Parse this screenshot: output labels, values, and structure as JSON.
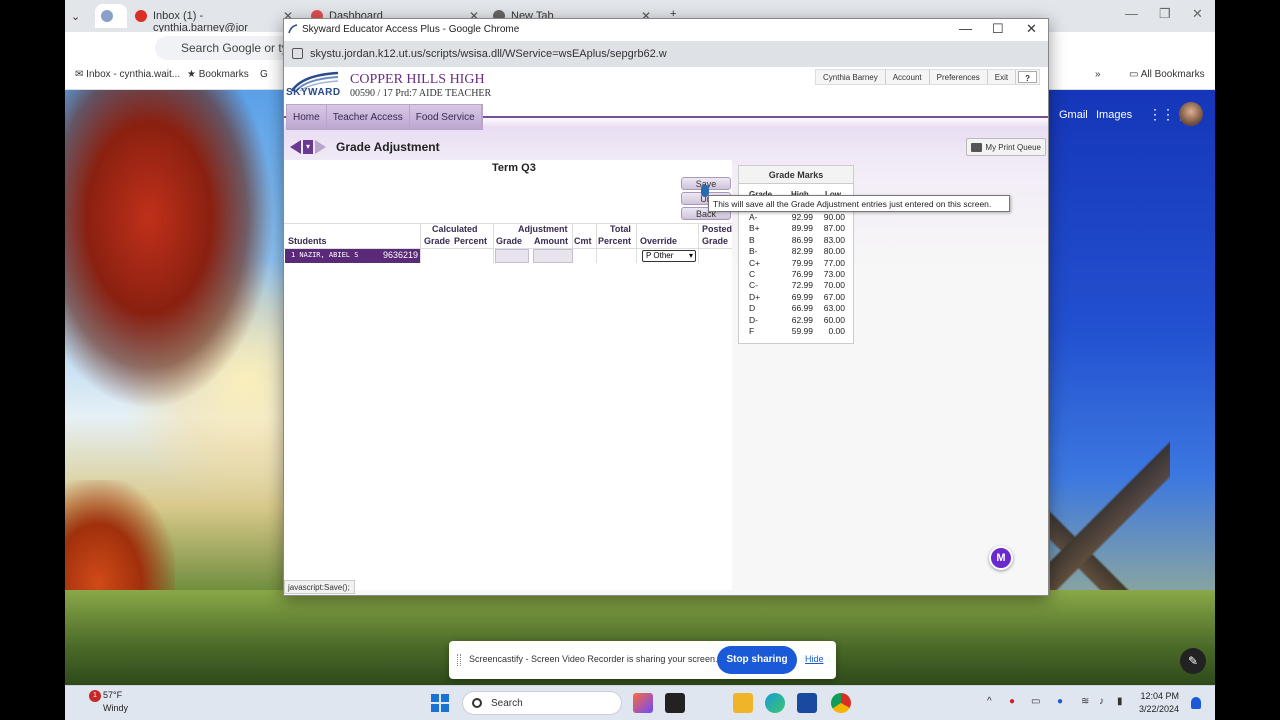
{
  "background_browser": {
    "tabs": [
      {
        "label": ""
      },
      {
        "label": "Inbox (1) - cynthia.barney@jor"
      },
      {
        "label": "Dashboard"
      },
      {
        "label": "New Tab"
      }
    ],
    "omnibox_placeholder": "Search Google or type",
    "bookmarks": [
      "Inbox - cynthia.wait...",
      "Bookmarks",
      "G"
    ],
    "all_bookmarks": "All Bookmarks",
    "google_links": [
      "Gmail",
      "Images"
    ]
  },
  "popup": {
    "title": "Skyward Educator Access Plus - Google Chrome",
    "url": "skystu.jordan.k12.ut.us/scripts/wsisa.dll/WService=wsEAplus/sepgrb62.w",
    "logo_text": "SKYWARD",
    "school_name": "COPPER HILLS HIGH",
    "school_sub": "00590 / 17 Prd:7 AIDE TEACHER",
    "top_links": [
      "Cynthia Barney",
      "Account",
      "Preferences",
      "Exit",
      "?"
    ],
    "nav": [
      "Home",
      "Teacher Access",
      "Food Service"
    ],
    "page_title": "Grade Adjustment",
    "print_queue": "My Print Queue",
    "term": "Term Q3",
    "buttons": {
      "save": "Save",
      "undo": "Un",
      "back": "Back"
    },
    "headers": {
      "students": "Students",
      "calculated": "Calculated",
      "grade": "Grade",
      "percent": "Percent",
      "adjustment": "Adjustment",
      "adj_grade": "Grade",
      "amount": "Amount",
      "cmt": "Cmt",
      "total": "Total",
      "total_percent": "Percent",
      "override": "Override",
      "posted": "Posted",
      "posted_grade": "Grade"
    },
    "student_row": {
      "name": "1 NAZIR, ABIEL S",
      "id": "9636219",
      "override": "P Other"
    },
    "grade_marks": {
      "title": "Grade Marks",
      "col_grade": "Grade",
      "col_high": "High",
      "col_low": "Low",
      "rows": [
        {
          "g": "A-",
          "h": "92.99",
          "l": "90.00"
        },
        {
          "g": "B+",
          "h": "89.99",
          "l": "87.00"
        },
        {
          "g": "B",
          "h": "86.99",
          "l": "83.00"
        },
        {
          "g": "B-",
          "h": "82.99",
          "l": "80.00"
        },
        {
          "g": "C+",
          "h": "79.99",
          "l": "77.00"
        },
        {
          "g": "C",
          "h": "76.99",
          "l": "73.00"
        },
        {
          "g": "C-",
          "h": "72.99",
          "l": "70.00"
        },
        {
          "g": "D+",
          "h": "69.99",
          "l": "67.00"
        },
        {
          "g": "D",
          "h": "66.99",
          "l": "63.00"
        },
        {
          "g": "D-",
          "h": "62.99",
          "l": "60.00"
        },
        {
          "g": "F",
          "h": "59.99",
          "l": "0.00"
        }
      ]
    },
    "tooltip": "This will save all the Grade Adjustment entries just entered on this screen.",
    "status": "javascript:Save();",
    "badge": "M"
  },
  "share_bar": {
    "message": "Screencastify - Screen Video Recorder is sharing your screen.",
    "stop": "Stop sharing",
    "hide": "Hide"
  },
  "taskbar": {
    "temp": "57°F",
    "condition": "Windy",
    "weather_badge": "1",
    "search": "Search",
    "time": "12:04 PM",
    "date": "3/22/2024"
  }
}
